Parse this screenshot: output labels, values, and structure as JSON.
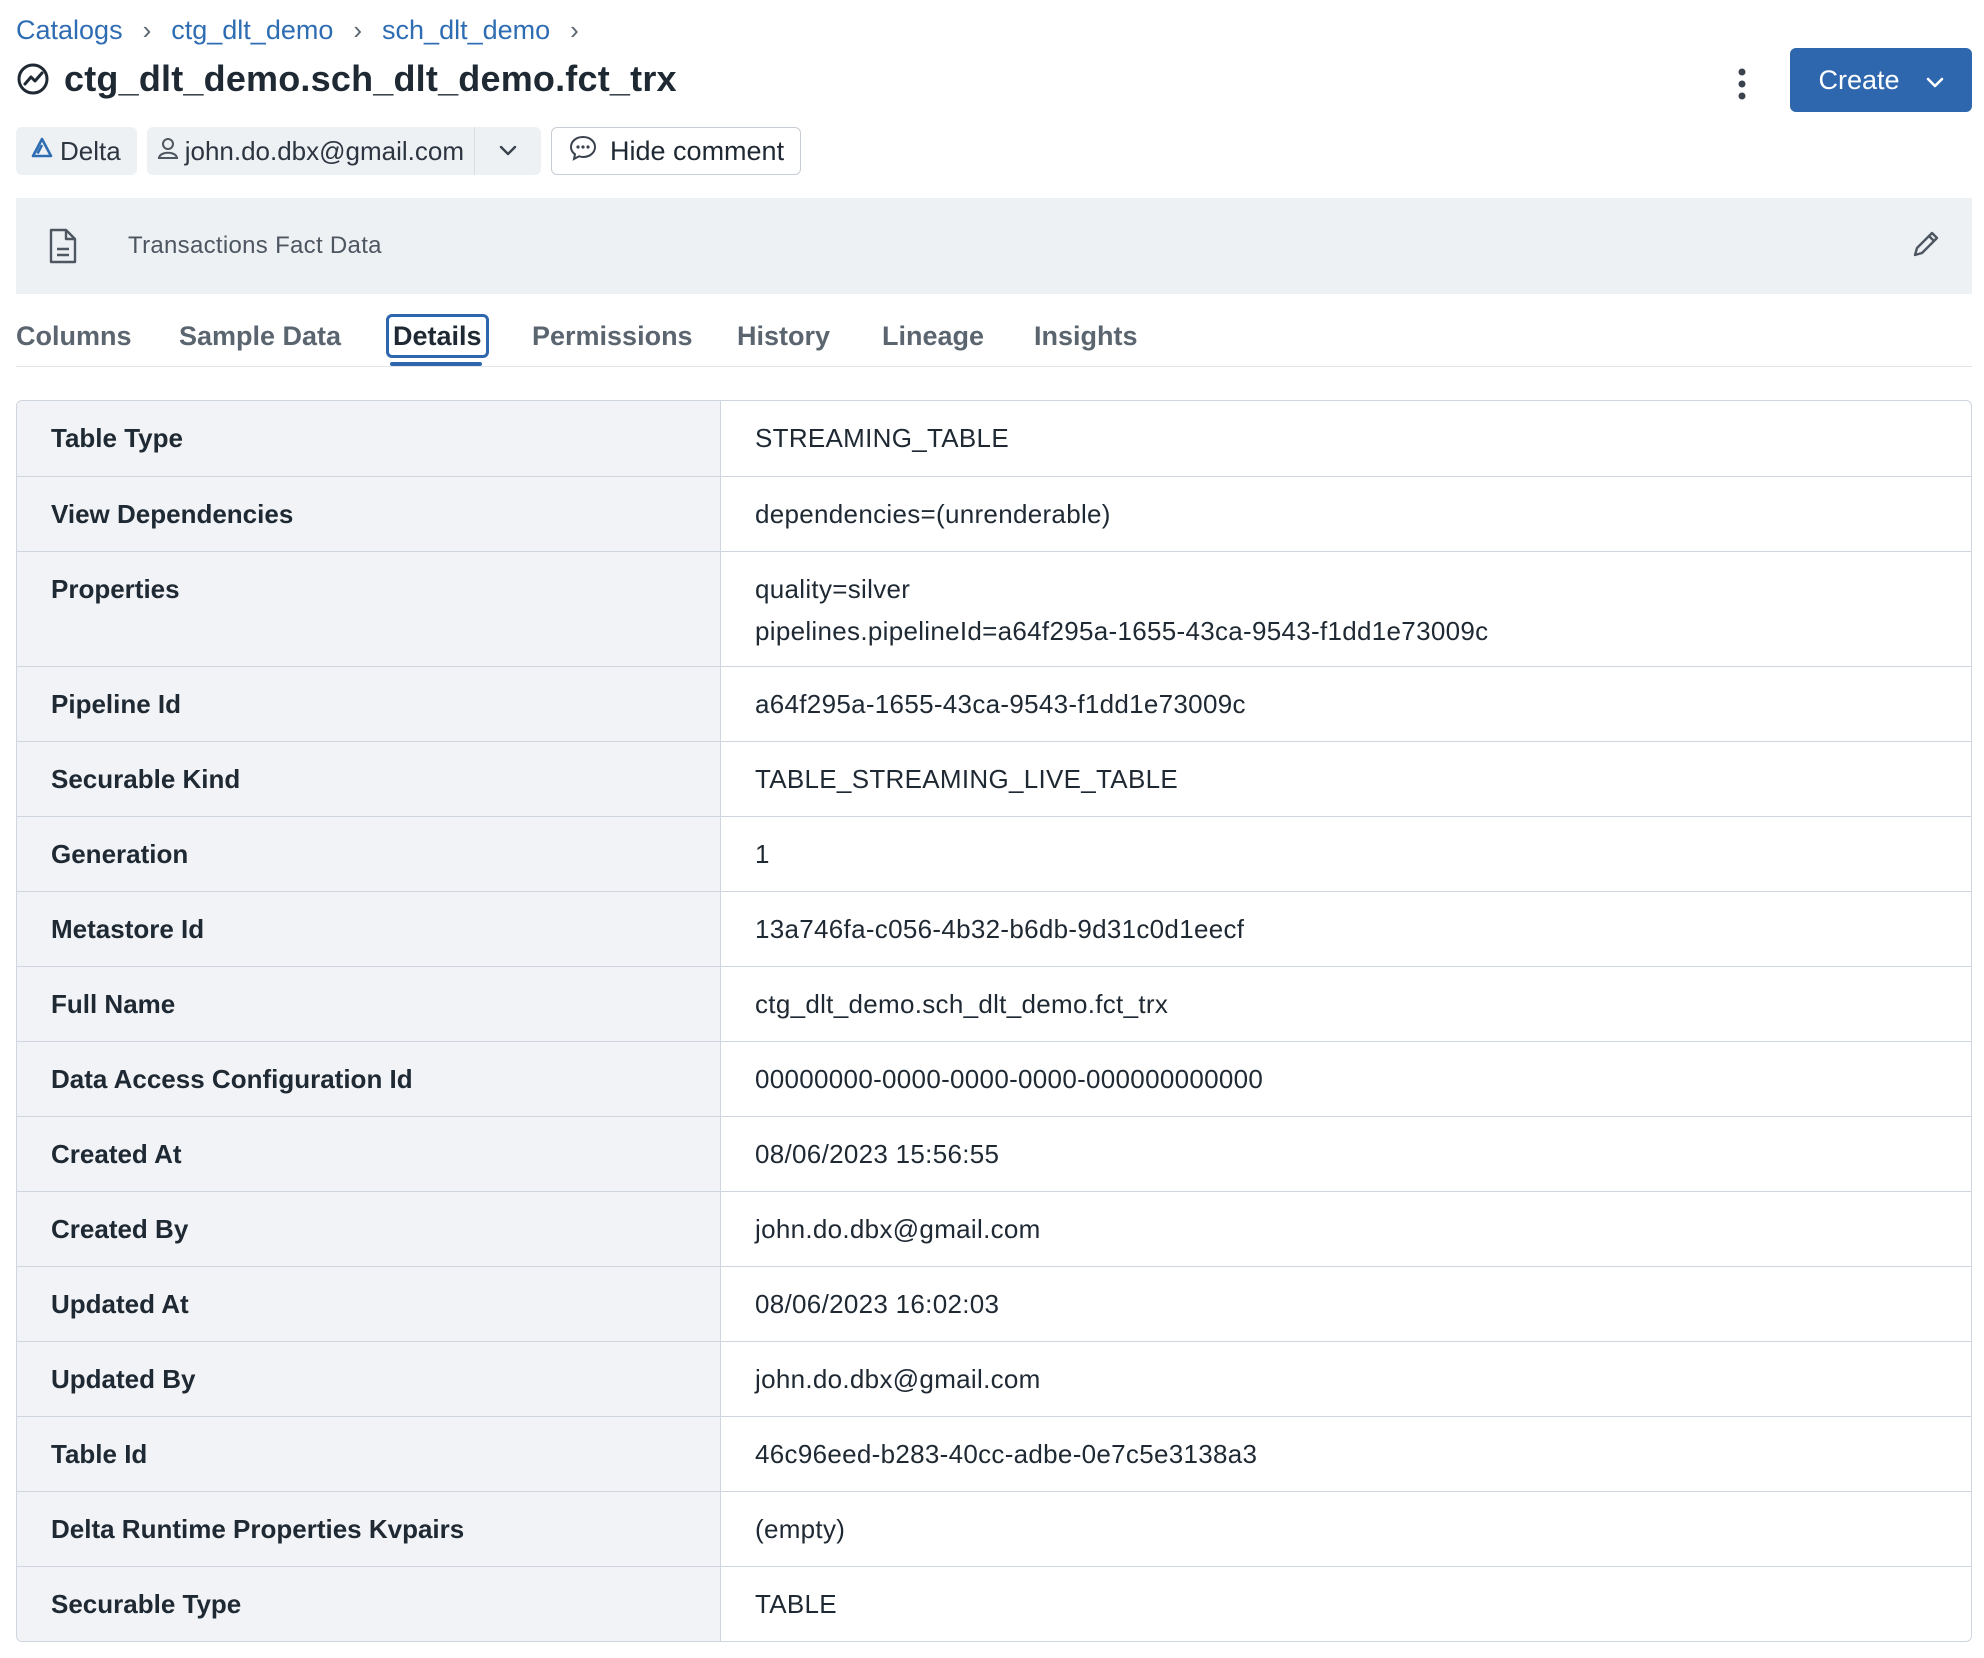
{
  "breadcrumb": {
    "items": [
      "Catalogs",
      "ctg_dlt_demo",
      "sch_dlt_demo"
    ],
    "separator": "›"
  },
  "title": "ctg_dlt_demo.sch_dlt_demo.fct_trx",
  "header": {
    "create_label": "Create",
    "create_color": "#2e67ae"
  },
  "chips": {
    "format": "Delta",
    "owner": "john.do.dbx@gmail.com",
    "hide_comment": "Hide comment"
  },
  "comment": {
    "text": "Transactions Fact Data"
  },
  "tabs": [
    {
      "label": "Columns"
    },
    {
      "label": "Sample Data"
    },
    {
      "label": "Details"
    },
    {
      "label": "Permissions"
    },
    {
      "label": "History"
    },
    {
      "label": "Lineage"
    },
    {
      "label": "Insights"
    }
  ],
  "active_tab": "Details",
  "details": [
    {
      "key": "Table Type",
      "value": "STREAMING_TABLE"
    },
    {
      "key": "View Dependencies",
      "value": "dependencies=(unrenderable)"
    },
    {
      "key": "Properties",
      "value": "quality=silver",
      "value2": "pipelines.pipelineId=a64f295a-1655-43ca-9543-f1dd1e73009c"
    },
    {
      "key": "Pipeline Id",
      "value": "a64f295a-1655-43ca-9543-f1dd1e73009c"
    },
    {
      "key": "Securable Kind",
      "value": "TABLE_STREAMING_LIVE_TABLE"
    },
    {
      "key": "Generation",
      "value": "1"
    },
    {
      "key": "Metastore Id",
      "value": "13a746fa-c056-4b32-b6db-9d31c0d1eecf"
    },
    {
      "key": "Full Name",
      "value": "ctg_dlt_demo.sch_dlt_demo.fct_trx"
    },
    {
      "key": "Data Access Configuration Id",
      "value": "00000000-0000-0000-0000-000000000000"
    },
    {
      "key": "Created At",
      "value": "08/06/2023 15:56:55"
    },
    {
      "key": "Created By",
      "value": "john.do.dbx@gmail.com"
    },
    {
      "key": "Updated At",
      "value": "08/06/2023 16:02:03"
    },
    {
      "key": "Updated By",
      "value": "john.do.dbx@gmail.com"
    },
    {
      "key": "Table Id",
      "value": "46c96eed-b283-40cc-adbe-0e7c5e3138a3"
    },
    {
      "key": "Delta Runtime Properties Kvpairs",
      "value": "(empty)"
    },
    {
      "key": "Securable Type",
      "value": "TABLE"
    }
  ]
}
